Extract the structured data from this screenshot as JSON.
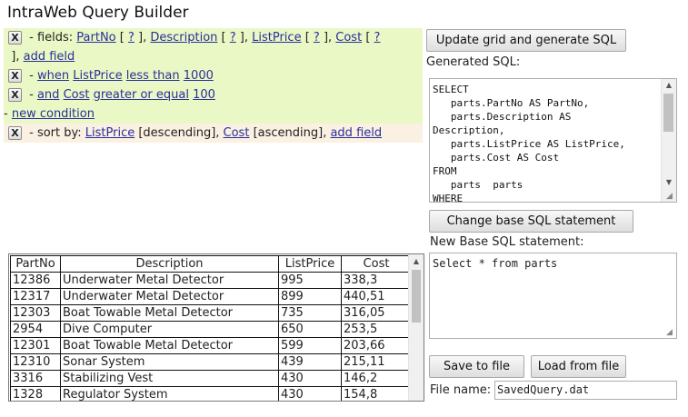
{
  "app": {
    "title": "IntraWeb Query Builder"
  },
  "query": {
    "fields_row": {
      "remove": "X",
      "prefix": " - fields: ",
      "fields": [
        {
          "name": "PartNo",
          "q": "?"
        },
        {
          "name": "Description",
          "q": "?"
        },
        {
          "name": "ListPrice",
          "q": "?"
        },
        {
          "name": "Cost",
          "q": "?"
        }
      ],
      "add_field": "add field"
    },
    "conditions": [
      {
        "remove": "X",
        "conj": "when",
        "field": "ListPrice",
        "op": "less than",
        "value": "1000"
      },
      {
        "remove": "X",
        "conj": "and",
        "field": "Cost",
        "op": "greater or equal",
        "value": "100"
      }
    ],
    "new_condition": "new condition",
    "sort_row": {
      "remove": "X",
      "prefix": " - sort by: ",
      "sorts": [
        {
          "field": "ListPrice",
          "dir": "[descending]"
        },
        {
          "field": "Cost",
          "dir": "[ascending]"
        }
      ],
      "add_field": "add field"
    }
  },
  "right": {
    "update_button": "Update grid and generate SQL",
    "generated_label": "Generated SQL:",
    "sql_text": "SELECT\n   parts.PartNo AS PartNo,\n   parts.Description AS\nDescription,\n   parts.ListPrice AS ListPrice,\n   parts.Cost AS Cost\nFROM\n   parts  parts\nWHERE",
    "change_base_button": "Change base SQL statement",
    "new_base_label": "New Base SQL statement:",
    "base_sql": "Select * from parts",
    "save_button": "Save to file",
    "load_button": "Load from file",
    "file_label": "File name:",
    "file_value": "SavedQuery.dat"
  },
  "grid": {
    "columns": [
      "PartNo",
      "Description",
      "ListPrice",
      "Cost"
    ],
    "rows": [
      [
        "12386",
        "Underwater Metal Detector",
        "995",
        "338,3"
      ],
      [
        "12317",
        "Underwater Metal Detector",
        "899",
        "440,51"
      ],
      [
        "12303",
        "Boat Towable Metal Detector",
        "735",
        "316,05"
      ],
      [
        "2954",
        "Dive Computer",
        "650",
        "253,5"
      ],
      [
        "12301",
        "Boat Towable Metal Detector",
        "599",
        "203,66"
      ],
      [
        "12310",
        "Sonar System",
        "439",
        "215,11"
      ],
      [
        "3316",
        "Stabilizing Vest",
        "430",
        "146,2"
      ],
      [
        "1328",
        "Regulator System",
        "430",
        "154,8"
      ]
    ]
  }
}
